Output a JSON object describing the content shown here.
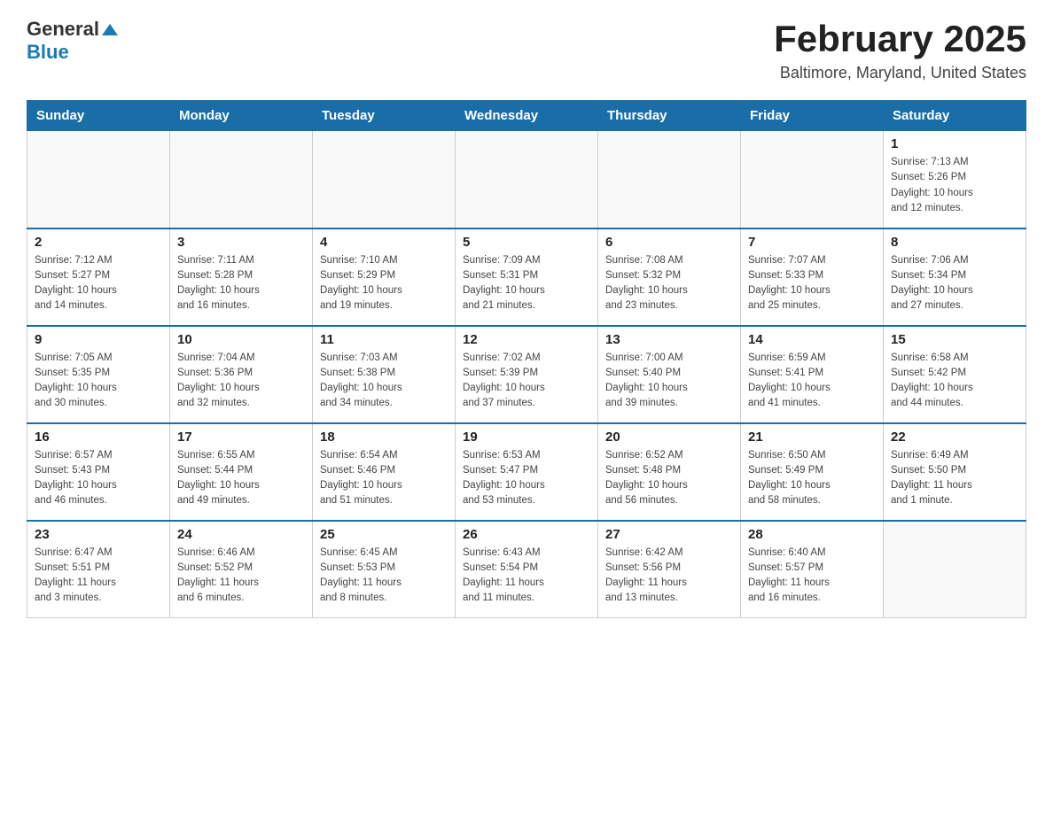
{
  "logo": {
    "general": "General",
    "blue": "Blue"
  },
  "title": "February 2025",
  "subtitle": "Baltimore, Maryland, United States",
  "days_header": [
    "Sunday",
    "Monday",
    "Tuesday",
    "Wednesday",
    "Thursday",
    "Friday",
    "Saturday"
  ],
  "weeks": [
    [
      {
        "day": "",
        "info": ""
      },
      {
        "day": "",
        "info": ""
      },
      {
        "day": "",
        "info": ""
      },
      {
        "day": "",
        "info": ""
      },
      {
        "day": "",
        "info": ""
      },
      {
        "day": "",
        "info": ""
      },
      {
        "day": "1",
        "info": "Sunrise: 7:13 AM\nSunset: 5:26 PM\nDaylight: 10 hours\nand 12 minutes."
      }
    ],
    [
      {
        "day": "2",
        "info": "Sunrise: 7:12 AM\nSunset: 5:27 PM\nDaylight: 10 hours\nand 14 minutes."
      },
      {
        "day": "3",
        "info": "Sunrise: 7:11 AM\nSunset: 5:28 PM\nDaylight: 10 hours\nand 16 minutes."
      },
      {
        "day": "4",
        "info": "Sunrise: 7:10 AM\nSunset: 5:29 PM\nDaylight: 10 hours\nand 19 minutes."
      },
      {
        "day": "5",
        "info": "Sunrise: 7:09 AM\nSunset: 5:31 PM\nDaylight: 10 hours\nand 21 minutes."
      },
      {
        "day": "6",
        "info": "Sunrise: 7:08 AM\nSunset: 5:32 PM\nDaylight: 10 hours\nand 23 minutes."
      },
      {
        "day": "7",
        "info": "Sunrise: 7:07 AM\nSunset: 5:33 PM\nDaylight: 10 hours\nand 25 minutes."
      },
      {
        "day": "8",
        "info": "Sunrise: 7:06 AM\nSunset: 5:34 PM\nDaylight: 10 hours\nand 27 minutes."
      }
    ],
    [
      {
        "day": "9",
        "info": "Sunrise: 7:05 AM\nSunset: 5:35 PM\nDaylight: 10 hours\nand 30 minutes."
      },
      {
        "day": "10",
        "info": "Sunrise: 7:04 AM\nSunset: 5:36 PM\nDaylight: 10 hours\nand 32 minutes."
      },
      {
        "day": "11",
        "info": "Sunrise: 7:03 AM\nSunset: 5:38 PM\nDaylight: 10 hours\nand 34 minutes."
      },
      {
        "day": "12",
        "info": "Sunrise: 7:02 AM\nSunset: 5:39 PM\nDaylight: 10 hours\nand 37 minutes."
      },
      {
        "day": "13",
        "info": "Sunrise: 7:00 AM\nSunset: 5:40 PM\nDaylight: 10 hours\nand 39 minutes."
      },
      {
        "day": "14",
        "info": "Sunrise: 6:59 AM\nSunset: 5:41 PM\nDaylight: 10 hours\nand 41 minutes."
      },
      {
        "day": "15",
        "info": "Sunrise: 6:58 AM\nSunset: 5:42 PM\nDaylight: 10 hours\nand 44 minutes."
      }
    ],
    [
      {
        "day": "16",
        "info": "Sunrise: 6:57 AM\nSunset: 5:43 PM\nDaylight: 10 hours\nand 46 minutes."
      },
      {
        "day": "17",
        "info": "Sunrise: 6:55 AM\nSunset: 5:44 PM\nDaylight: 10 hours\nand 49 minutes."
      },
      {
        "day": "18",
        "info": "Sunrise: 6:54 AM\nSunset: 5:46 PM\nDaylight: 10 hours\nand 51 minutes."
      },
      {
        "day": "19",
        "info": "Sunrise: 6:53 AM\nSunset: 5:47 PM\nDaylight: 10 hours\nand 53 minutes."
      },
      {
        "day": "20",
        "info": "Sunrise: 6:52 AM\nSunset: 5:48 PM\nDaylight: 10 hours\nand 56 minutes."
      },
      {
        "day": "21",
        "info": "Sunrise: 6:50 AM\nSunset: 5:49 PM\nDaylight: 10 hours\nand 58 minutes."
      },
      {
        "day": "22",
        "info": "Sunrise: 6:49 AM\nSunset: 5:50 PM\nDaylight: 11 hours\nand 1 minute."
      }
    ],
    [
      {
        "day": "23",
        "info": "Sunrise: 6:47 AM\nSunset: 5:51 PM\nDaylight: 11 hours\nand 3 minutes."
      },
      {
        "day": "24",
        "info": "Sunrise: 6:46 AM\nSunset: 5:52 PM\nDaylight: 11 hours\nand 6 minutes."
      },
      {
        "day": "25",
        "info": "Sunrise: 6:45 AM\nSunset: 5:53 PM\nDaylight: 11 hours\nand 8 minutes."
      },
      {
        "day": "26",
        "info": "Sunrise: 6:43 AM\nSunset: 5:54 PM\nDaylight: 11 hours\nand 11 minutes."
      },
      {
        "day": "27",
        "info": "Sunrise: 6:42 AM\nSunset: 5:56 PM\nDaylight: 11 hours\nand 13 minutes."
      },
      {
        "day": "28",
        "info": "Sunrise: 6:40 AM\nSunset: 5:57 PM\nDaylight: 11 hours\nand 16 minutes."
      },
      {
        "day": "",
        "info": ""
      }
    ]
  ]
}
